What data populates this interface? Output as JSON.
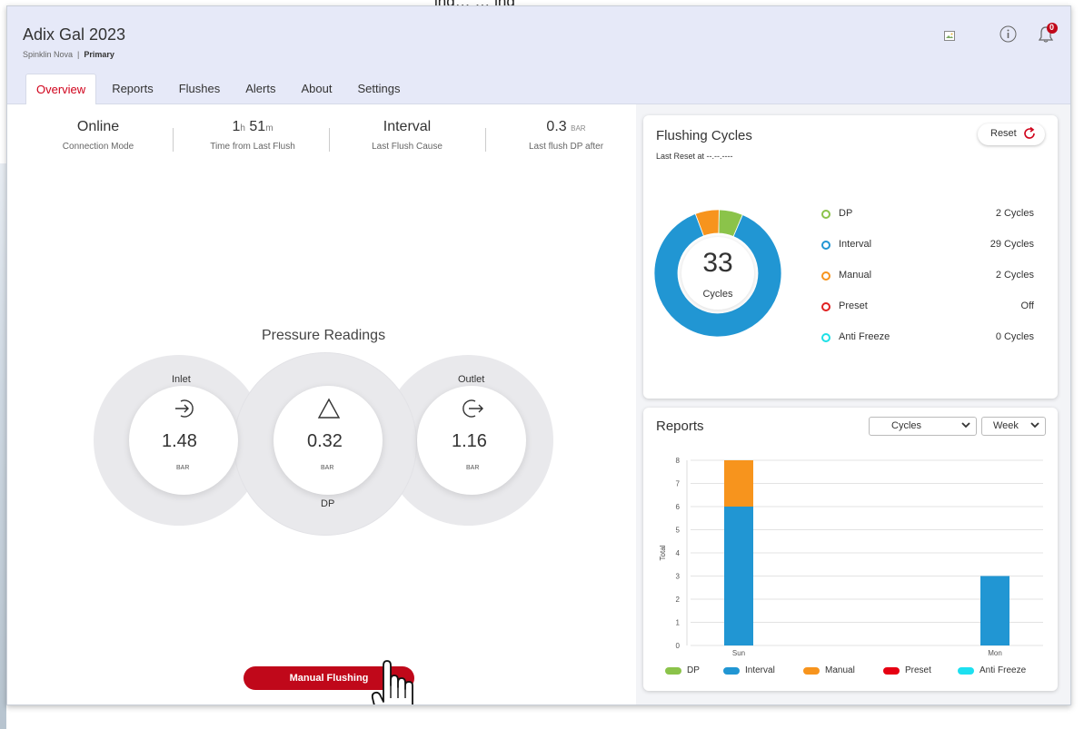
{
  "top_fragment": "ing… … ing",
  "header": {
    "title": "Adix Gal 2023",
    "subtitle_model": "Spinklin Nova",
    "subtitle_sep": "|",
    "subtitle_role": "Primary",
    "notification_count": "0",
    "icons": [
      "image-icon",
      "info-icon",
      "bell-icon"
    ]
  },
  "tabs": [
    {
      "label": "Overview",
      "active": true
    },
    {
      "label": "Reports"
    },
    {
      "label": "Flushes"
    },
    {
      "label": "Alerts"
    },
    {
      "label": "About"
    },
    {
      "label": "Settings"
    }
  ],
  "stats": {
    "connection": {
      "value": "Online",
      "label": "Connection Mode"
    },
    "time": {
      "h": "1",
      "h_unit": "h",
      "m": "51",
      "m_unit": "m",
      "label": "Time from Last Flush"
    },
    "cause": {
      "value": "Interval",
      "label": "Last Flush Cause"
    },
    "dp_after": {
      "value": "0.3",
      "unit": "BAR",
      "label": "Last flush DP after"
    }
  },
  "pressure": {
    "title": "Pressure Readings",
    "inlet": {
      "label": "Inlet",
      "value": "1.48",
      "unit": "BAR"
    },
    "dp": {
      "label": "DP",
      "value": "0.32",
      "unit": "BAR"
    },
    "outlet": {
      "label": "Outlet",
      "value": "1.16",
      "unit": "BAR"
    }
  },
  "manual_button": "Manual Flushing",
  "flushing_cycles": {
    "title": "Flushing Cycles",
    "last_reset": "Last Reset at --.--.----",
    "reset_label": "Reset",
    "total": "33",
    "total_label": "Cycles",
    "legend": [
      {
        "name": "DP",
        "count": "2 Cycles",
        "color": "#8bc34a"
      },
      {
        "name": "Interval",
        "count": "29 Cycles",
        "color": "#2196d3"
      },
      {
        "name": "Manual",
        "count": "2 Cycles",
        "color": "#f7941d"
      },
      {
        "name": "Preset",
        "count": "Off",
        "color": "#e02020"
      },
      {
        "name": "Anti Freeze",
        "count": "0 Cycles",
        "color": "#1de0e6"
      }
    ]
  },
  "reports": {
    "title": "Reports",
    "select_metric": "Cycles",
    "select_period": "Week"
  },
  "chart_data": [
    {
      "type": "pie",
      "categories": [
        "DP",
        "Interval",
        "Manual",
        "Preset",
        "Anti Freeze"
      ],
      "values": [
        2,
        29,
        2,
        0,
        0
      ],
      "colors": [
        "#8bc34a",
        "#2196d3",
        "#f7941d",
        "#e02020",
        "#1de0e6"
      ],
      "donut": true,
      "center_text": "33"
    },
    {
      "type": "bar",
      "stacked": true,
      "categories": [
        "Sun",
        "Mon"
      ],
      "series": [
        {
          "name": "DP",
          "values": [
            0,
            0
          ],
          "color": "#8bc34a"
        },
        {
          "name": "Interval",
          "values": [
            6,
            3
          ],
          "color": "#2196d3"
        },
        {
          "name": "Manual",
          "values": [
            2,
            0
          ],
          "color": "#f7941d"
        },
        {
          "name": "Preset",
          "values": [
            0,
            0
          ],
          "color": "#e60012"
        },
        {
          "name": "Anti Freeze",
          "values": [
            0,
            0
          ],
          "color": "#1de0f0"
        }
      ],
      "ylabel": "Total",
      "ylim": [
        0,
        8
      ],
      "yticks": [
        "0",
        "1",
        "2",
        "3",
        "4",
        "5",
        "6",
        "7",
        "8"
      ],
      "grid": true,
      "legend_position": "bottom"
    }
  ]
}
